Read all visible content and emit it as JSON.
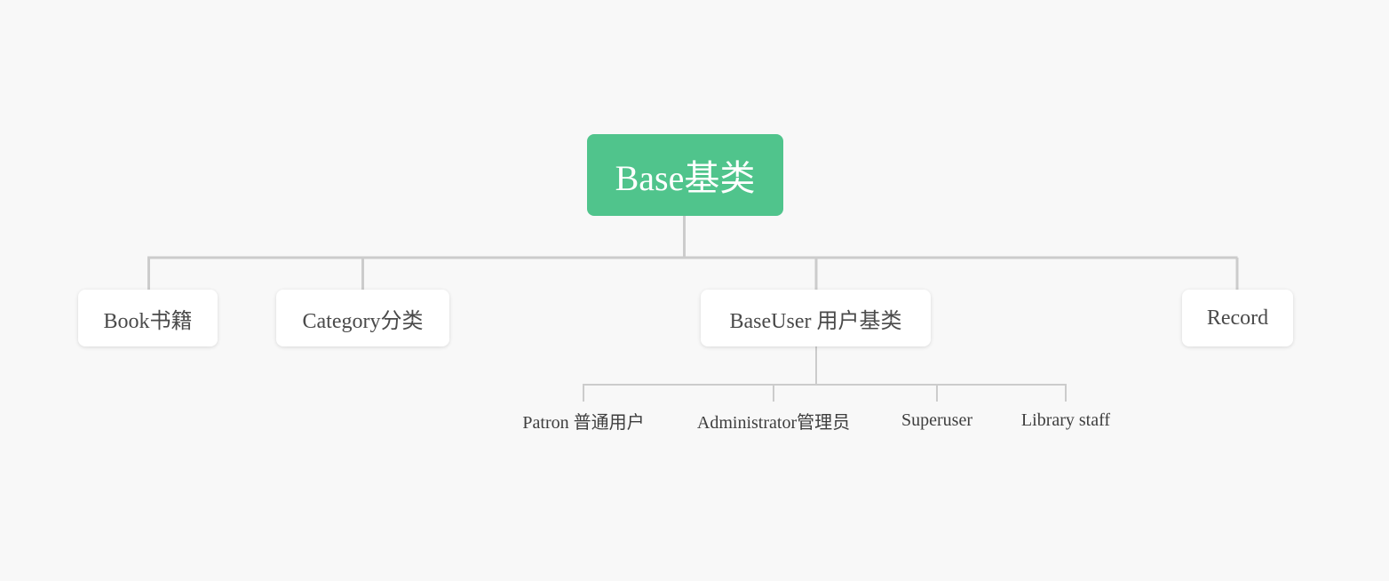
{
  "diagram": {
    "root": {
      "label": "Base基类",
      "color": "#50c48c"
    },
    "children": [
      {
        "label": "Book书籍"
      },
      {
        "label": "Category分类"
      },
      {
        "label": "BaseUser 用户基类",
        "children": [
          {
            "label": "Patron 普通用户"
          },
          {
            "label": "Administrator管理员"
          },
          {
            "label": "Superuser"
          },
          {
            "label": "Library staff"
          }
        ]
      },
      {
        "label": "Record"
      }
    ],
    "connector_color": "#cccccc",
    "background": "#f8f8f8"
  }
}
